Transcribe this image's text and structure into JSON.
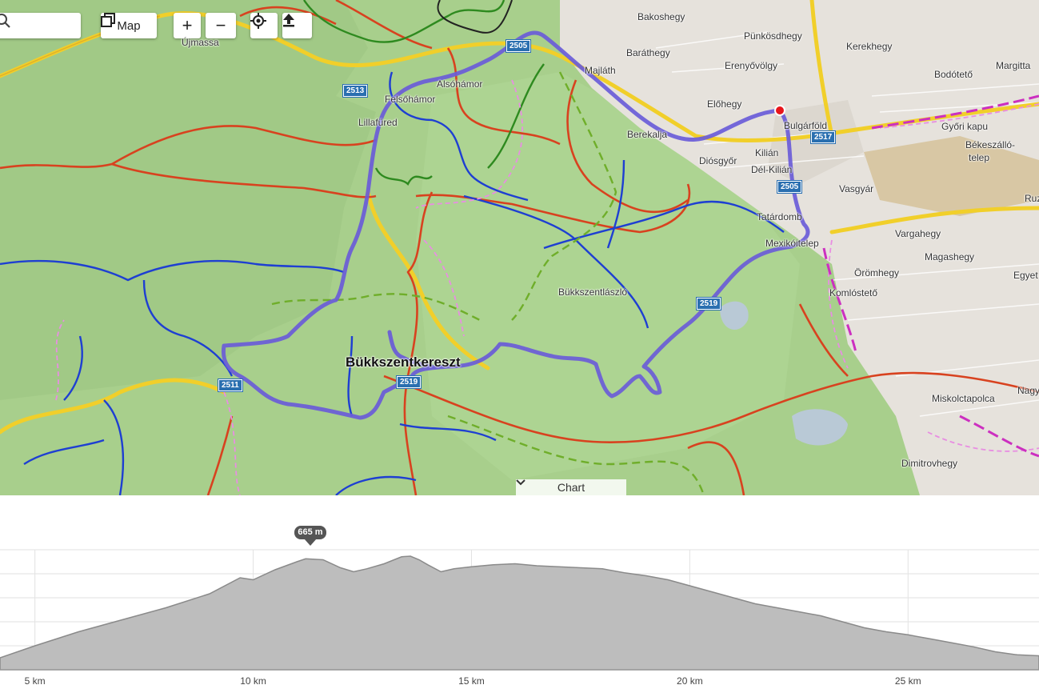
{
  "toolbar": {
    "map_label": "Map",
    "zoom_in_label": "+",
    "zoom_out_label": "−"
  },
  "map": {
    "places": [
      {
        "name": "Bakoshegy"
      },
      {
        "name": "Pünkösdhegy"
      },
      {
        "name": "Kerekhegy"
      },
      {
        "name": "Margitta"
      },
      {
        "name": "Baráthegy"
      },
      {
        "name": "Erenyővölgy"
      },
      {
        "name": "Bodótető"
      },
      {
        "name": "Újmassa"
      },
      {
        "name": "Majláth"
      },
      {
        "name": "Alsóhámor"
      },
      {
        "name": "Felsőhámor"
      },
      {
        "name": "Lillafüred"
      },
      {
        "name": "Előhegy"
      },
      {
        "name": "Bulgárföld"
      },
      {
        "name": "Győri kapu"
      },
      {
        "name": "Berekalja"
      },
      {
        "name": "Kilián"
      },
      {
        "name": "Békeszálló-"
      },
      {
        "name": "telep"
      },
      {
        "name": "Diósgyőr"
      },
      {
        "name": "Dél-Kilián"
      },
      {
        "name": "Vasgyár"
      },
      {
        "name": "Ruz"
      },
      {
        "name": "Tatárdomb"
      },
      {
        "name": "Mexikóitelep"
      },
      {
        "name": "Vargahegy"
      },
      {
        "name": "Magashegy"
      },
      {
        "name": "Örömhegy"
      },
      {
        "name": "Egyet"
      },
      {
        "name": "Komlóstető"
      },
      {
        "name": "Bükkszentlászló"
      },
      {
        "name": "Bükkszentkereszt"
      },
      {
        "name": "Miskolctapolca"
      },
      {
        "name": "Nagy"
      },
      {
        "name": "Dimitrovhegy"
      }
    ],
    "road_shields": [
      "2505",
      "2513",
      "2517",
      "2505",
      "2519",
      "2511",
      "2519"
    ],
    "chart_toggle_label": "Chart"
  },
  "elevation": {
    "peak_label": "665 m",
    "route_color": "#6a5cd8"
  },
  "chart_data": {
    "type": "area",
    "title": "",
    "xlabel": "",
    "ylabel": "",
    "x_tick_labels": [
      "5 km",
      "10 km",
      "15 km",
      "20 km",
      "25 km"
    ],
    "xlim": [
      4.2,
      28
    ],
    "ylim": [
      110,
      710
    ],
    "x": [
      4.2,
      5,
      6,
      7,
      8,
      9,
      9.7,
      10,
      10.5,
      11,
      11.2,
      11.6,
      12,
      12.3,
      12.6,
      13,
      13.4,
      13.6,
      13.8,
      14,
      14.3,
      14.6,
      15,
      15.5,
      16,
      16.5,
      17,
      17.5,
      18,
      18.5,
      19,
      19.5,
      20,
      20.5,
      21,
      21.5,
      22,
      22.5,
      23,
      23.5,
      24,
      24.5,
      25,
      25.5,
      26,
      26.5,
      27,
      27.5,
      28
    ],
    "values": [
      170,
      230,
      300,
      360,
      420,
      490,
      570,
      560,
      610,
      650,
      665,
      660,
      620,
      600,
      615,
      640,
      675,
      678,
      660,
      635,
      600,
      615,
      625,
      635,
      640,
      630,
      625,
      620,
      615,
      595,
      580,
      560,
      530,
      500,
      470,
      440,
      420,
      400,
      380,
      350,
      320,
      300,
      285,
      265,
      245,
      225,
      200,
      185,
      180
    ]
  }
}
